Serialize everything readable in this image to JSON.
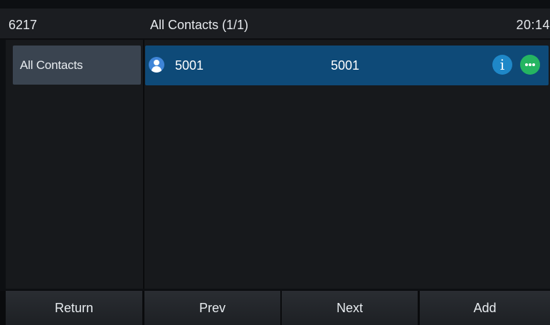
{
  "statusbar": {
    "account": "6217",
    "title": "All Contacts (1/1)",
    "time": "20:14"
  },
  "sidebar": {
    "items": [
      {
        "label": "All Contacts",
        "selected": true
      }
    ]
  },
  "contacts": [
    {
      "name": "5001",
      "number": "5001",
      "avatar_icon": "person-icon",
      "actions": [
        {
          "icon": "info-icon",
          "glyph": "i",
          "color": "#1f88c8"
        },
        {
          "icon": "more-icon",
          "color": "#25b561"
        }
      ]
    }
  ],
  "softkeys": {
    "return_label": "Return",
    "prev_label": "Prev",
    "next_label": "Next",
    "add_label": "Add"
  },
  "colors": {
    "selected_row": "#0e4a78",
    "selected_group": "#3a4450"
  }
}
